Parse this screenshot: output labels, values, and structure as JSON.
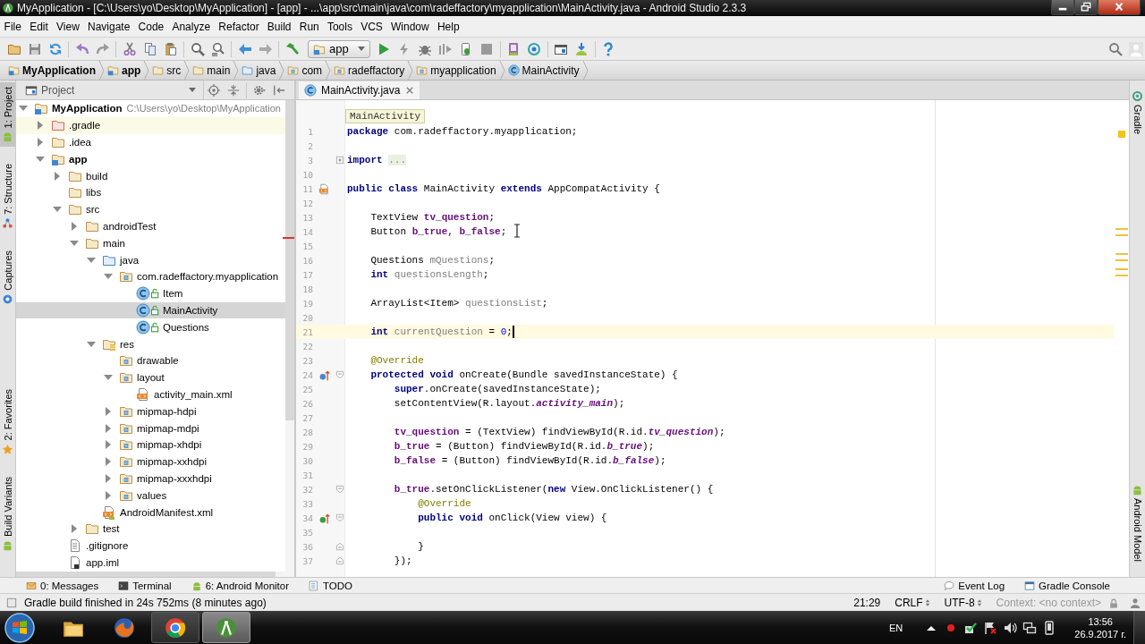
{
  "window": {
    "title": "MyApplication - [C:\\Users\\yo\\Desktop\\MyApplication] - [app] - ...\\app\\src\\main\\java\\com\\radeffactory\\myapplication\\MainActivity.java - Android Studio 2.3.3"
  },
  "menu": [
    "File",
    "Edit",
    "View",
    "Navigate",
    "Code",
    "Analyze",
    "Refactor",
    "Build",
    "Run",
    "Tools",
    "VCS",
    "Window",
    "Help"
  ],
  "toolbar": {
    "run_config": "app"
  },
  "navigation_bar": [
    {
      "label": "MyApplication",
      "kind": "module"
    },
    {
      "label": "app",
      "kind": "module"
    },
    {
      "label": "src",
      "kind": "folder"
    },
    {
      "label": "main",
      "kind": "folder"
    },
    {
      "label": "java",
      "kind": "source"
    },
    {
      "label": "com",
      "kind": "package"
    },
    {
      "label": "radeffactory",
      "kind": "package"
    },
    {
      "label": "myapplication",
      "kind": "package"
    },
    {
      "label": "MainActivity",
      "kind": "class"
    }
  ],
  "left_stripe": {
    "top": [
      {
        "label": "1: Project",
        "kind": "project",
        "selected": true
      },
      {
        "label": "7: Structure",
        "kind": "structure",
        "selected": false
      },
      {
        "label": "Captures",
        "kind": "captures",
        "selected": false
      }
    ],
    "bottom": [
      {
        "label": "2: Favorites",
        "kind": "favorites",
        "selected": false
      },
      {
        "label": "Build Variants",
        "kind": "variants",
        "selected": false
      }
    ]
  },
  "project_panel": {
    "view": "Project",
    "tree": [
      {
        "label": "MyApplication",
        "path": "C:\\Users\\yo\\Desktop\\MyApplication",
        "kind": "module",
        "expanded": true,
        "selected": false,
        "highlighted": false,
        "children": [
          {
            "label": ".gradle",
            "kind": "excluded",
            "expanded": false,
            "selected": false,
            "highlighted": true
          },
          {
            "label": ".idea",
            "kind": "folder",
            "expanded": false,
            "selected": false,
            "highlighted": false
          },
          {
            "label": "app",
            "kind": "module",
            "expanded": true,
            "selected": false,
            "highlighted": false,
            "children": [
              {
                "label": "build",
                "kind": "folder",
                "expanded": false,
                "selected": false,
                "highlighted": false
              },
              {
                "label": "libs",
                "kind": "folder",
                "selected": false,
                "highlighted": false
              },
              {
                "label": "src",
                "kind": "folder",
                "expanded": true,
                "selected": false,
                "highlighted": false,
                "children": [
                  {
                    "label": "androidTest",
                    "kind": "folder",
                    "expanded": false,
                    "selected": false,
                    "highlighted": false
                  },
                  {
                    "label": "main",
                    "kind": "folder",
                    "expanded": true,
                    "selected": false,
                    "highlighted": false,
                    "children": [
                      {
                        "label": "java",
                        "kind": "source",
                        "expanded": true,
                        "selected": false,
                        "highlighted": false,
                        "children": [
                          {
                            "label": "com.radeffactory.myapplication",
                            "kind": "package",
                            "expanded": true,
                            "selected": false,
                            "highlighted": false,
                            "children": [
                              {
                                "label": "Item",
                                "kind": "class",
                                "selected": false,
                                "highlighted": false
                              },
                              {
                                "label": "MainActivity",
                                "kind": "class",
                                "selected": true,
                                "highlighted": false
                              },
                              {
                                "label": "Questions",
                                "kind": "class",
                                "selected": false,
                                "highlighted": false
                              }
                            ]
                          }
                        ]
                      },
                      {
                        "label": "res",
                        "kind": "resources",
                        "expanded": true,
                        "selected": false,
                        "highlighted": false,
                        "children": [
                          {
                            "label": "drawable",
                            "kind": "package",
                            "selected": false,
                            "highlighted": false
                          },
                          {
                            "label": "layout",
                            "kind": "package",
                            "expanded": true,
                            "selected": false,
                            "highlighted": false,
                            "children": [
                              {
                                "label": "activity_main.xml",
                                "kind": "xml",
                                "selected": false,
                                "highlighted": false
                              }
                            ]
                          },
                          {
                            "label": "mipmap-hdpi",
                            "kind": "package",
                            "expanded": false,
                            "selected": false,
                            "highlighted": false
                          },
                          {
                            "label": "mipmap-mdpi",
                            "kind": "package",
                            "expanded": false,
                            "selected": false,
                            "highlighted": false
                          },
                          {
                            "label": "mipmap-xhdpi",
                            "kind": "package",
                            "expanded": false,
                            "selected": false,
                            "highlighted": false
                          },
                          {
                            "label": "mipmap-xxhdpi",
                            "kind": "package",
                            "expanded": false,
                            "selected": false,
                            "highlighted": false
                          },
                          {
                            "label": "mipmap-xxxhdpi",
                            "kind": "package",
                            "expanded": false,
                            "selected": false,
                            "highlighted": false
                          },
                          {
                            "label": "values",
                            "kind": "package",
                            "expanded": false,
                            "selected": false,
                            "highlighted": false
                          }
                        ]
                      },
                      {
                        "label": "AndroidManifest.xml",
                        "kind": "manifest",
                        "selected": false,
                        "highlighted": false
                      }
                    ]
                  },
                  {
                    "label": "test",
                    "kind": "folder",
                    "expanded": false,
                    "selected": false,
                    "highlighted": false
                  }
                ]
              },
              {
                "label": ".gitignore",
                "kind": "text",
                "selected": false,
                "highlighted": false
              },
              {
                "label": "app.iml",
                "kind": "iml",
                "selected": false,
                "highlighted": false
              }
            ]
          }
        ]
      }
    ]
  },
  "editor": {
    "tabs": [
      {
        "label": "MainActivity.java",
        "kind": "class",
        "selected": true
      }
    ],
    "scope": "MainActivity",
    "lines": [
      {
        "number": "1",
        "current": false,
        "segments": [
          {
            "kind": "kw",
            "text": "package"
          },
          {
            "kind": "plain",
            "text": " com.radeffactory.myapplication;"
          }
        ]
      },
      {
        "number": "2",
        "current": false
      },
      {
        "number": "3",
        "current": false,
        "fold": {
          "kind": "expand"
        },
        "segments": [
          {
            "kind": "kw",
            "text": "import "
          },
          {
            "kind": "folded",
            "text": "..."
          }
        ]
      },
      {
        "number": "10",
        "current": false
      },
      {
        "number": "11",
        "current": false,
        "gutter": {
          "kind": "layout"
        },
        "segments": [
          {
            "kind": "kw",
            "text": "public class"
          },
          {
            "kind": "plain",
            "text": " MainActivity "
          },
          {
            "kind": "kw",
            "text": "extends"
          },
          {
            "kind": "plain",
            "text": " AppCompatActivity {"
          }
        ]
      },
      {
        "number": "12",
        "current": false
      },
      {
        "number": "13",
        "current": false,
        "segments": [
          {
            "kind": "plain",
            "text": "    TextView "
          },
          {
            "kind": "field",
            "text": "tv_question"
          },
          {
            "kind": "plain",
            "text": ";"
          }
        ]
      },
      {
        "number": "14",
        "current": false,
        "segments": [
          {
            "kind": "plain",
            "text": "    Button "
          },
          {
            "kind": "field",
            "text": "b_true"
          },
          {
            "kind": "plain",
            "text": ", "
          },
          {
            "kind": "field",
            "text": "b_false"
          },
          {
            "kind": "plain",
            "text": ";"
          }
        ]
      },
      {
        "number": "15",
        "current": false
      },
      {
        "number": "16",
        "current": false,
        "segments": [
          {
            "kind": "plain",
            "text": "    Questions "
          },
          {
            "kind": "unused",
            "text": "mQuestions"
          },
          {
            "kind": "plain",
            "text": ";"
          }
        ]
      },
      {
        "number": "17",
        "current": false,
        "segments": [
          {
            "kind": "kw",
            "text": "    int"
          },
          {
            "kind": "unused",
            "text": " questionsLength"
          },
          {
            "kind": "plain",
            "text": ";"
          }
        ]
      },
      {
        "number": "18",
        "current": false
      },
      {
        "number": "19",
        "current": false,
        "segments": [
          {
            "kind": "plain",
            "text": "    ArrayList<Item> "
          },
          {
            "kind": "unused",
            "text": "questionsList"
          },
          {
            "kind": "plain",
            "text": ";"
          }
        ]
      },
      {
        "number": "20",
        "current": false
      },
      {
        "number": "21",
        "current": true,
        "segments": [
          {
            "kind": "kw",
            "text": "    int"
          },
          {
            "kind": "unused",
            "text": " currentQuestion"
          },
          {
            "kind": "plain",
            "text": " = "
          },
          {
            "kind": "number",
            "text": "0"
          },
          {
            "kind": "plain",
            "text": ";"
          }
        ]
      },
      {
        "number": "22",
        "current": false
      },
      {
        "number": "23",
        "current": false,
        "segments": [
          {
            "kind": "annotation",
            "text": "    @Override"
          }
        ]
      },
      {
        "number": "24",
        "current": false,
        "gutter": {
          "kind": "override"
        },
        "fold": {
          "kind": "start"
        },
        "segments": [
          {
            "kind": "kw",
            "text": "    protected void"
          },
          {
            "kind": "plain",
            "text": " onCreate(Bundle savedInstanceState) {"
          }
        ]
      },
      {
        "number": "25",
        "current": false,
        "segments": [
          {
            "kind": "kw",
            "text": "        super"
          },
          {
            "kind": "plain",
            "text": ".onCreate(savedInstanceState);"
          }
        ]
      },
      {
        "number": "26",
        "current": false,
        "segments": [
          {
            "kind": "plain",
            "text": "        setContentView(R.layout."
          },
          {
            "kind": "static",
            "text": "activity_main"
          },
          {
            "kind": "plain",
            "text": ");"
          }
        ]
      },
      {
        "number": "27",
        "current": false
      },
      {
        "number": "28",
        "current": false,
        "segments": [
          {
            "kind": "field",
            "text": "        tv_question"
          },
          {
            "kind": "plain",
            "text": " = (TextView) findViewById(R.id."
          },
          {
            "kind": "static",
            "text": "tv_question"
          },
          {
            "kind": "plain",
            "text": ");"
          }
        ]
      },
      {
        "number": "29",
        "current": false,
        "segments": [
          {
            "kind": "field",
            "text": "        b_true"
          },
          {
            "kind": "plain",
            "text": " = (Button) findViewById(R.id."
          },
          {
            "kind": "static",
            "text": "b_true"
          },
          {
            "kind": "plain",
            "text": ");"
          }
        ]
      },
      {
        "number": "30",
        "current": false,
        "segments": [
          {
            "kind": "field",
            "text": "        b_false"
          },
          {
            "kind": "plain",
            "text": " = (Button) findViewById(R.id."
          },
          {
            "kind": "static",
            "text": "b_false"
          },
          {
            "kind": "plain",
            "text": ");"
          }
        ]
      },
      {
        "number": "31",
        "current": false
      },
      {
        "number": "32",
        "current": false,
        "fold": {
          "kind": "start"
        },
        "segments": [
          {
            "kind": "field",
            "text": "        b_true"
          },
          {
            "kind": "plain",
            "text": ".setOnClickListener("
          },
          {
            "kind": "kw",
            "text": "new"
          },
          {
            "kind": "plain",
            "text": " View.OnClickListener() {"
          }
        ]
      },
      {
        "number": "33",
        "current": false,
        "segments": [
          {
            "kind": "annotation",
            "text": "            @Override"
          }
        ]
      },
      {
        "number": "34",
        "current": false,
        "gutter": {
          "kind": "implements"
        },
        "fold": {
          "kind": "start"
        },
        "segments": [
          {
            "kind": "kw",
            "text": "            public void"
          },
          {
            "kind": "plain",
            "text": " onClick(View view) {"
          }
        ]
      },
      {
        "number": "35",
        "current": false
      },
      {
        "number": "36",
        "current": false,
        "fold": {
          "kind": "end"
        },
        "segments": [
          {
            "kind": "plain",
            "text": "            }"
          }
        ]
      },
      {
        "number": "37",
        "current": false,
        "fold": {
          "kind": "end"
        },
        "segments": [
          {
            "kind": "plain",
            "text": "        });"
          }
        ]
      }
    ]
  },
  "right_stripe": {
    "top": [
      {
        "label": "Gradle",
        "kind": "gradle",
        "selected": false
      }
    ],
    "bottom": [
      {
        "label": "Android Model",
        "kind": "model",
        "selected": false
      }
    ]
  },
  "tool_buttons": {
    "left": [
      {
        "label": "0: Messages",
        "kind": "messages"
      },
      {
        "label": "Terminal",
        "kind": "terminal"
      },
      {
        "label": "6: Android Monitor",
        "kind": "monitor"
      },
      {
        "label": "TODO",
        "kind": "todo"
      }
    ],
    "right": [
      {
        "label": "Event Log",
        "kind": "log"
      },
      {
        "label": "Gradle Console",
        "kind": "console"
      }
    ]
  },
  "status_bar": {
    "message": "Gradle build finished in 24s 752ms (8 minutes ago)",
    "position": "21:29",
    "line_separator": "CRLF",
    "encoding": "UTF-8",
    "context": "Context: <no context>"
  },
  "taskbar": {
    "apps": [
      {
        "kind": "files",
        "running": false,
        "selected": false
      },
      {
        "kind": "firefox",
        "running": false,
        "selected": false
      },
      {
        "kind": "chrome",
        "running": true,
        "selected": false
      },
      {
        "kind": "studio",
        "running": true,
        "selected": true
      }
    ],
    "language": "EN",
    "time": "13:56",
    "date": "26.9.2017 г."
  }
}
